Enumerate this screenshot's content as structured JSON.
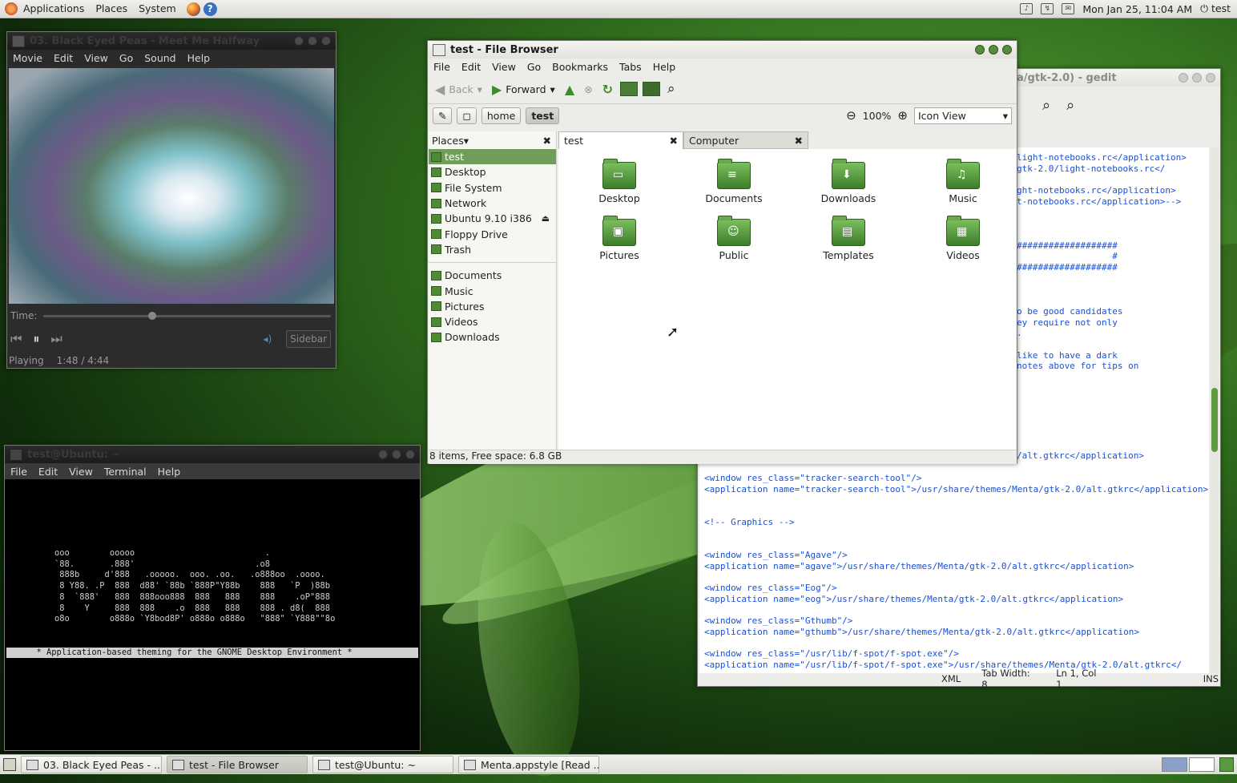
{
  "top_panel": {
    "menus": [
      "Applications",
      "Places",
      "System"
    ],
    "clock": "Mon Jan 25, 11:04 AM",
    "user": "test"
  },
  "totem": {
    "title": "03. Black Eyed Peas - Meet Me Halfway",
    "menus": [
      "Movie",
      "Edit",
      "View",
      "Go",
      "Sound",
      "Help"
    ],
    "time_label": "Time:",
    "progress_fraction": 0.364,
    "sidebar_label": "Sidebar",
    "status_state": "Playing",
    "status_time": "1:48 / 4:44"
  },
  "file_browser": {
    "title": "test - File Browser",
    "menus": [
      "File",
      "Edit",
      "View",
      "Go",
      "Bookmarks",
      "Tabs",
      "Help"
    ],
    "back_label": "Back",
    "forward_label": "Forward",
    "crumbs": [
      "home",
      "test"
    ],
    "zoom": "100%",
    "view_mode": "Icon View",
    "places_header": "Places",
    "places": [
      "test",
      "Desktop",
      "File System",
      "Network",
      "Ubuntu 9.10 i386",
      "Floppy Drive",
      "Trash"
    ],
    "bookmarks": [
      "Documents",
      "Music",
      "Pictures",
      "Videos",
      "Downloads"
    ],
    "tabs": [
      "test",
      "Computer"
    ],
    "items": [
      "Desktop",
      "Documents",
      "Downloads",
      "Music",
      "Pictures",
      "Public",
      "Templates",
      "Videos"
    ],
    "status": "8 items, Free space: 6.8 GB"
  },
  "gedit": {
    "title": "a/gtk-2.0) - gedit",
    "lines_top": [
      "light-notebooks.rc</application>",
      "gtk-2.0/light-notebooks.rc</",
      "",
      "ght-notebooks.rc</application>",
      "t-notebooks.rc</application>-->",
      "",
      "",
      "",
      "###################",
      "                  #",
      "###################",
      "",
      "",
      "",
      "o be good candidates",
      "ey require not only",
      ".",
      "",
      "like to have a dark",
      "notes above for tips on"
    ],
    "line_altrc": "/alt.gtkrc</application>",
    "lines_bottom": [
      "<window res_class=\"tracker-search-tool\"/>",
      "<application name=\"tracker-search-tool\">/usr/share/themes/Menta/gtk-2.0/alt.gtkrc</application>",
      "",
      "",
      "<!-- Graphics -->",
      "",
      "",
      "<window res_class=\"Agave\"/>",
      "<application name=\"agave\">/usr/share/themes/Menta/gtk-2.0/alt.gtkrc</application>",
      "",
      "<window res_class=\"Eog\"/>",
      "<application name=\"eog\">/usr/share/themes/Menta/gtk-2.0/alt.gtkrc</application>",
      "",
      "<window res_class=\"Gthumb\"/>",
      "<application name=\"gthumb\">/usr/share/themes/Menta/gtk-2.0/alt.gtkrc</application>",
      "",
      "<window res_class=\"/usr/lib/f-spot/f-spot.exe\"/>",
      "<application name=\"/usr/lib/f-spot/f-spot.exe\">/usr/share/themes/Menta/gtk-2.0/alt.gtkrc</"
    ],
    "status_lang": "XML",
    "status_tab": "Tab Width: 8",
    "status_pos": "Ln 1, Col 1",
    "status_mode": "INS"
  },
  "terminal": {
    "title": "test@Ubuntu: ~",
    "menus": [
      "File",
      "Edit",
      "View",
      "Terminal",
      "Help"
    ],
    "ascii_art": [
      "ooo        ooooo                          .",
      "`88.       .888'                        .o8",
      " 888b     d'888   .ooooo.  ooo. .oo.   .o888oo  .oooo.",
      " 8 Y88. .P  888  d88' `88b `888P\"Y88b    888   `P  )88b",
      " 8  `888'   888  888ooo888  888   888    888    .oP\"888",
      " 8    Y     888  888    .o  888   888    888 . d8(  888",
      "o8o        o888o `Y8bod8P' o888o o888o   \"888\" `Y888\"\"8o"
    ],
    "banner": "      * Application-based theming for the GNOME Desktop Environment *"
  },
  "taskbar": {
    "tasks": [
      "03. Black Eyed Peas - ...",
      "test - File Browser",
      "test@Ubuntu: ~",
      "Menta.appstyle [Read ..."
    ]
  }
}
